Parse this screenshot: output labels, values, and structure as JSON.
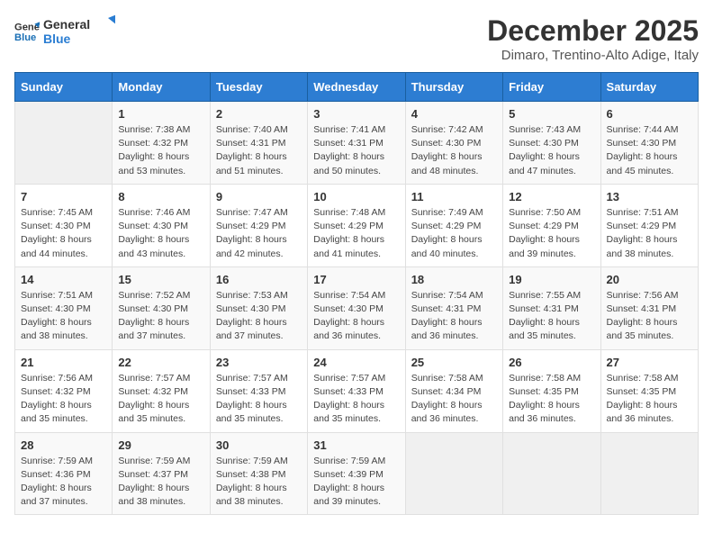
{
  "logo": {
    "line1": "General",
    "line2": "Blue"
  },
  "title": "December 2025",
  "subtitle": "Dimaro, Trentino-Alto Adige, Italy",
  "weekdays": [
    "Sunday",
    "Monday",
    "Tuesday",
    "Wednesday",
    "Thursday",
    "Friday",
    "Saturday"
  ],
  "weeks": [
    [
      {
        "day": "",
        "empty": true
      },
      {
        "day": "1",
        "sunrise": "7:38 AM",
        "sunset": "4:32 PM",
        "daylight": "8 hours and 53 minutes."
      },
      {
        "day": "2",
        "sunrise": "7:40 AM",
        "sunset": "4:31 PM",
        "daylight": "8 hours and 51 minutes."
      },
      {
        "day": "3",
        "sunrise": "7:41 AM",
        "sunset": "4:31 PM",
        "daylight": "8 hours and 50 minutes."
      },
      {
        "day": "4",
        "sunrise": "7:42 AM",
        "sunset": "4:30 PM",
        "daylight": "8 hours and 48 minutes."
      },
      {
        "day": "5",
        "sunrise": "7:43 AM",
        "sunset": "4:30 PM",
        "daylight": "8 hours and 47 minutes."
      },
      {
        "day": "6",
        "sunrise": "7:44 AM",
        "sunset": "4:30 PM",
        "daylight": "8 hours and 45 minutes."
      }
    ],
    [
      {
        "day": "7",
        "sunrise": "7:45 AM",
        "sunset": "4:30 PM",
        "daylight": "8 hours and 44 minutes."
      },
      {
        "day": "8",
        "sunrise": "7:46 AM",
        "sunset": "4:30 PM",
        "daylight": "8 hours and 43 minutes."
      },
      {
        "day": "9",
        "sunrise": "7:47 AM",
        "sunset": "4:29 PM",
        "daylight": "8 hours and 42 minutes."
      },
      {
        "day": "10",
        "sunrise": "7:48 AM",
        "sunset": "4:29 PM",
        "daylight": "8 hours and 41 minutes."
      },
      {
        "day": "11",
        "sunrise": "7:49 AM",
        "sunset": "4:29 PM",
        "daylight": "8 hours and 40 minutes."
      },
      {
        "day": "12",
        "sunrise": "7:50 AM",
        "sunset": "4:29 PM",
        "daylight": "8 hours and 39 minutes."
      },
      {
        "day": "13",
        "sunrise": "7:51 AM",
        "sunset": "4:29 PM",
        "daylight": "8 hours and 38 minutes."
      }
    ],
    [
      {
        "day": "14",
        "sunrise": "7:51 AM",
        "sunset": "4:30 PM",
        "daylight": "8 hours and 38 minutes."
      },
      {
        "day": "15",
        "sunrise": "7:52 AM",
        "sunset": "4:30 PM",
        "daylight": "8 hours and 37 minutes."
      },
      {
        "day": "16",
        "sunrise": "7:53 AM",
        "sunset": "4:30 PM",
        "daylight": "8 hours and 37 minutes."
      },
      {
        "day": "17",
        "sunrise": "7:54 AM",
        "sunset": "4:30 PM",
        "daylight": "8 hours and 36 minutes."
      },
      {
        "day": "18",
        "sunrise": "7:54 AM",
        "sunset": "4:31 PM",
        "daylight": "8 hours and 36 minutes."
      },
      {
        "day": "19",
        "sunrise": "7:55 AM",
        "sunset": "4:31 PM",
        "daylight": "8 hours and 35 minutes."
      },
      {
        "day": "20",
        "sunrise": "7:56 AM",
        "sunset": "4:31 PM",
        "daylight": "8 hours and 35 minutes."
      }
    ],
    [
      {
        "day": "21",
        "sunrise": "7:56 AM",
        "sunset": "4:32 PM",
        "daylight": "8 hours and 35 minutes."
      },
      {
        "day": "22",
        "sunrise": "7:57 AM",
        "sunset": "4:32 PM",
        "daylight": "8 hours and 35 minutes."
      },
      {
        "day": "23",
        "sunrise": "7:57 AM",
        "sunset": "4:33 PM",
        "daylight": "8 hours and 35 minutes."
      },
      {
        "day": "24",
        "sunrise": "7:57 AM",
        "sunset": "4:33 PM",
        "daylight": "8 hours and 35 minutes."
      },
      {
        "day": "25",
        "sunrise": "7:58 AM",
        "sunset": "4:34 PM",
        "daylight": "8 hours and 36 minutes."
      },
      {
        "day": "26",
        "sunrise": "7:58 AM",
        "sunset": "4:35 PM",
        "daylight": "8 hours and 36 minutes."
      },
      {
        "day": "27",
        "sunrise": "7:58 AM",
        "sunset": "4:35 PM",
        "daylight": "8 hours and 36 minutes."
      }
    ],
    [
      {
        "day": "28",
        "sunrise": "7:59 AM",
        "sunset": "4:36 PM",
        "daylight": "8 hours and 37 minutes."
      },
      {
        "day": "29",
        "sunrise": "7:59 AM",
        "sunset": "4:37 PM",
        "daylight": "8 hours and 38 minutes."
      },
      {
        "day": "30",
        "sunrise": "7:59 AM",
        "sunset": "4:38 PM",
        "daylight": "8 hours and 38 minutes."
      },
      {
        "day": "31",
        "sunrise": "7:59 AM",
        "sunset": "4:39 PM",
        "daylight": "8 hours and 39 minutes."
      },
      {
        "day": "",
        "empty": true
      },
      {
        "day": "",
        "empty": true
      },
      {
        "day": "",
        "empty": true
      }
    ]
  ],
  "labels": {
    "sunrise": "Sunrise:",
    "sunset": "Sunset:",
    "daylight": "Daylight:"
  }
}
